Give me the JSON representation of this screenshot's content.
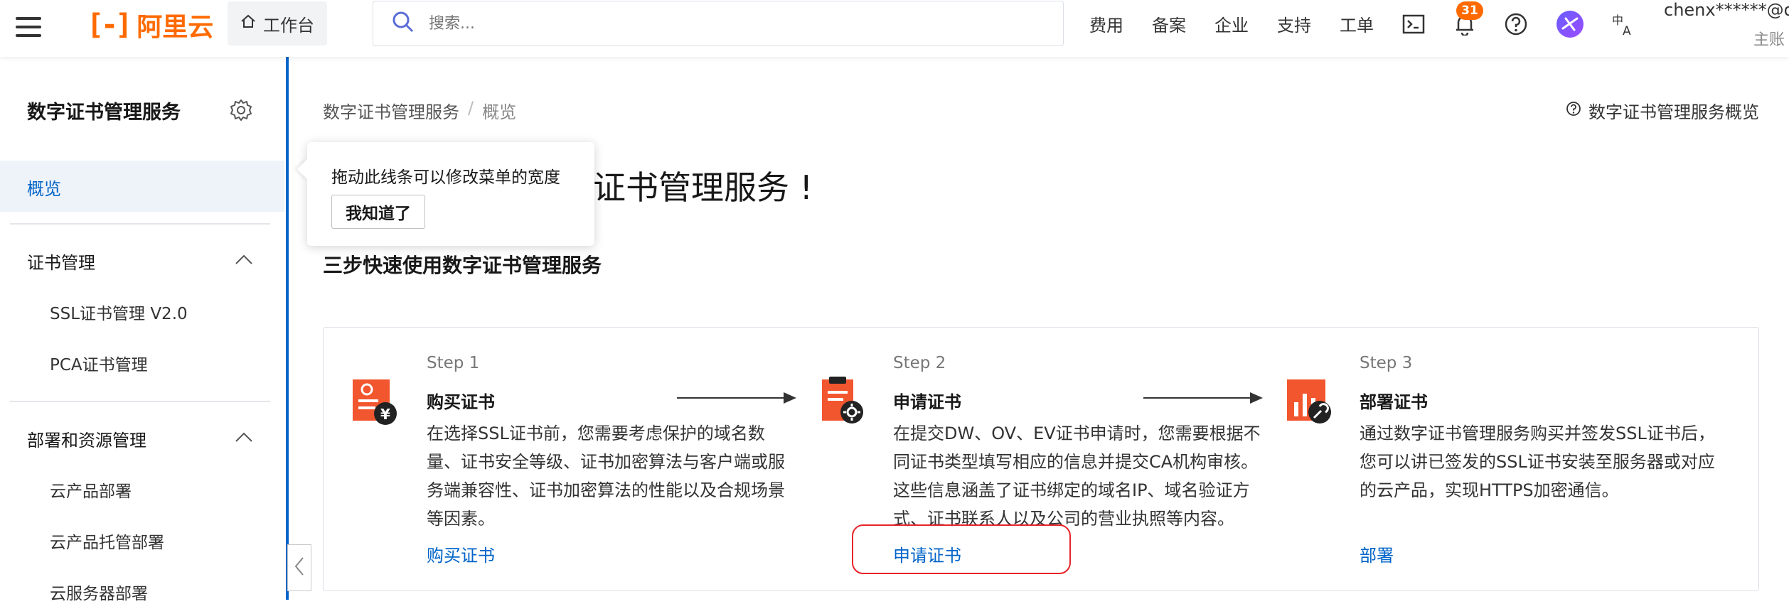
{
  "topbar": {
    "logo_text": "阿里云",
    "logo_mark": "[-]",
    "workbench_label": "工作台",
    "search_placeholder": "搜索...",
    "nav": [
      "费用",
      "备案",
      "企业",
      "支持",
      "工单"
    ],
    "notification_count": "31",
    "account_name": "chenx******@o...",
    "account_role": "主账",
    "icons": [
      "menu-icon",
      "home-icon",
      "search-icon",
      "terminal-icon",
      "bell-icon",
      "help-icon",
      "app-icon",
      "translate-icon"
    ],
    "brand_color": "#ff6a00"
  },
  "sidebar": {
    "title": "数字证书管理服务",
    "active_item": "概览",
    "groups": [
      {
        "label": "证书管理",
        "items": [
          "SSL证书管理 V2.0",
          "PCA证书管理"
        ]
      },
      {
        "label": "部署和资源管理",
        "items": [
          "云产品部署",
          "云产品托管部署",
          "云服务器部署"
        ]
      }
    ],
    "accent_color": "#0064c8"
  },
  "breadcrumb": {
    "root": "数字证书管理服务",
    "sep": "/",
    "current": "概览"
  },
  "help_link": "数字证书管理服务概览",
  "welcome_visible": "证书管理服务 !",
  "steps_heading": "三步快速使用数字证书管理服务",
  "steps": [
    {
      "label": "Step 1",
      "title": "购买证书",
      "desc": "在选择SSL证书前，您需要考虑保护的域名数量、证书安全等级、证书加密算法与客户端或服务端兼容性、证书加密算法的性能以及合规场景等因素。",
      "link": "购买证书",
      "icon": "purchase-cert-icon"
    },
    {
      "label": "Step 2",
      "title": "申请证书",
      "desc": "在提交DW、OV、EV证书申请时，您需要根据不同证书类型填写相应的信息并提交CA机构审核。这些信息涵盖了证书绑定的域名IP、域名验证方式、证书联系人以及公司的营业执照等内容。",
      "link": "申请证书",
      "icon": "apply-cert-icon"
    },
    {
      "label": "Step 3",
      "title": "部署证书",
      "desc": "通过数字证书管理服务购买并签发SSL证书后，您可以讲已签发的SSL证书安装至服务器或对应的云产品，实现HTTPS加密通信。",
      "link": "部署",
      "icon": "deploy-cert-icon"
    }
  ],
  "tooltip": {
    "text": "拖动此线条可以修改菜单的宽度",
    "button": "我知道了"
  },
  "highlight_color": "#e6242a"
}
